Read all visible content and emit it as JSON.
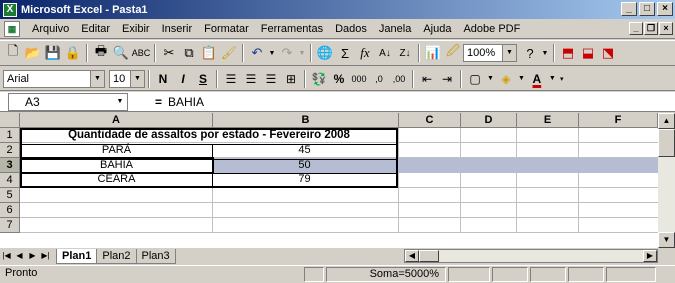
{
  "window": {
    "title": "Microsoft Excel - Pasta1",
    "app_icon": "X",
    "min": "_",
    "max": "□",
    "close": "×"
  },
  "menu": {
    "items": [
      "Arquivo",
      "Editar",
      "Exibir",
      "Inserir",
      "Formatar",
      "Ferramentas",
      "Dados",
      "Janela",
      "Ajuda",
      "Adobe PDF"
    ],
    "doc_min": "_",
    "doc_restore": "❐",
    "doc_close": "×"
  },
  "toolbar": {
    "zoom": "100%"
  },
  "format": {
    "font": "Arial",
    "size": "10",
    "bold": "N",
    "italic": "I",
    "underline": "S",
    "percent": "%",
    "thousands": "000",
    "inc_dec": ",0",
    "dec_dec": ",00"
  },
  "formula": {
    "cell_ref": "A3",
    "eq": "=",
    "value": "BAHIA"
  },
  "grid": {
    "columns": [
      "A",
      "B",
      "C",
      "D",
      "E",
      "F"
    ],
    "rows": [
      "1",
      "2",
      "3",
      "4",
      "5",
      "6",
      "7"
    ],
    "title": "Quantidade de assaltos por estado - Fevereiro 2008",
    "data": [
      {
        "state": "PARÁ",
        "value": "45"
      },
      {
        "state": "BAHIA",
        "value": "50"
      },
      {
        "state": "CEARÁ",
        "value": "79"
      }
    ]
  },
  "sheets": [
    "Plan1",
    "Plan2",
    "Plan3"
  ],
  "status": {
    "left": "Pronto",
    "sum": "Soma=5000%"
  }
}
